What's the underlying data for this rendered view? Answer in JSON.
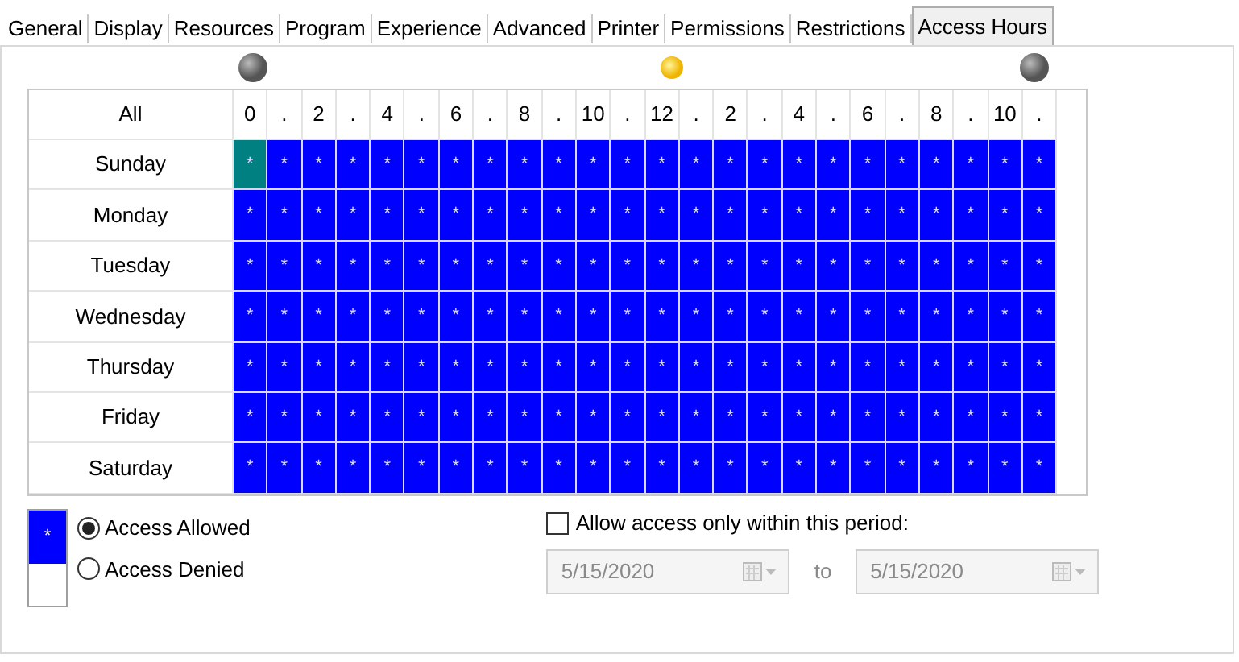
{
  "tabs": [
    {
      "label": "General",
      "selected": false
    },
    {
      "label": "Display",
      "selected": false
    },
    {
      "label": "Resources",
      "selected": false
    },
    {
      "label": "Program",
      "selected": false
    },
    {
      "label": "Experience",
      "selected": false
    },
    {
      "label": "Advanced",
      "selected": false
    },
    {
      "label": "Printer",
      "selected": false
    },
    {
      "label": "Permissions",
      "selected": false
    },
    {
      "label": "Restrictions",
      "selected": false
    },
    {
      "label": "Access Hours",
      "selected": true
    }
  ],
  "grid": {
    "all_label": "All",
    "hour_headers": [
      "0",
      ".",
      "2",
      ".",
      "4",
      ".",
      "6",
      ".",
      "8",
      ".",
      "10",
      ".",
      "12",
      ".",
      "2",
      ".",
      "4",
      ".",
      "6",
      ".",
      "8",
      ".",
      "10",
      "."
    ],
    "rows": [
      {
        "day": "Sunday",
        "cells": [
          {
            "mark": "*",
            "allowed": true,
            "selected": true
          },
          {
            "mark": "*",
            "allowed": true,
            "selected": false
          },
          {
            "mark": "*",
            "allowed": true,
            "selected": false
          },
          {
            "mark": "*",
            "allowed": true,
            "selected": false
          },
          {
            "mark": "*",
            "allowed": true,
            "selected": false
          },
          {
            "mark": "*",
            "allowed": true,
            "selected": false
          },
          {
            "mark": "*",
            "allowed": true,
            "selected": false
          },
          {
            "mark": "*",
            "allowed": true,
            "selected": false
          },
          {
            "mark": "*",
            "allowed": true,
            "selected": false
          },
          {
            "mark": "*",
            "allowed": true,
            "selected": false
          },
          {
            "mark": "*",
            "allowed": true,
            "selected": false
          },
          {
            "mark": "*",
            "allowed": true,
            "selected": false
          },
          {
            "mark": "*",
            "allowed": true,
            "selected": false
          },
          {
            "mark": "*",
            "allowed": true,
            "selected": false
          },
          {
            "mark": "*",
            "allowed": true,
            "selected": false
          },
          {
            "mark": "*",
            "allowed": true,
            "selected": false
          },
          {
            "mark": "*",
            "allowed": true,
            "selected": false
          },
          {
            "mark": "*",
            "allowed": true,
            "selected": false
          },
          {
            "mark": "*",
            "allowed": true,
            "selected": false
          },
          {
            "mark": "*",
            "allowed": true,
            "selected": false
          },
          {
            "mark": "*",
            "allowed": true,
            "selected": false
          },
          {
            "mark": "*",
            "allowed": true,
            "selected": false
          },
          {
            "mark": "*",
            "allowed": true,
            "selected": false
          },
          {
            "mark": "*",
            "allowed": true,
            "selected": false
          }
        ]
      },
      {
        "day": "Monday",
        "cells": [
          {
            "mark": "*",
            "allowed": true,
            "selected": false
          },
          {
            "mark": "*",
            "allowed": true,
            "selected": false
          },
          {
            "mark": "*",
            "allowed": true,
            "selected": false
          },
          {
            "mark": "*",
            "allowed": true,
            "selected": false
          },
          {
            "mark": "*",
            "allowed": true,
            "selected": false
          },
          {
            "mark": "*",
            "allowed": true,
            "selected": false
          },
          {
            "mark": "*",
            "allowed": true,
            "selected": false
          },
          {
            "mark": "*",
            "allowed": true,
            "selected": false
          },
          {
            "mark": "*",
            "allowed": true,
            "selected": false
          },
          {
            "mark": "*",
            "allowed": true,
            "selected": false
          },
          {
            "mark": "*",
            "allowed": true,
            "selected": false
          },
          {
            "mark": "*",
            "allowed": true,
            "selected": false
          },
          {
            "mark": "*",
            "allowed": true,
            "selected": false
          },
          {
            "mark": "*",
            "allowed": true,
            "selected": false
          },
          {
            "mark": "*",
            "allowed": true,
            "selected": false
          },
          {
            "mark": "*",
            "allowed": true,
            "selected": false
          },
          {
            "mark": "*",
            "allowed": true,
            "selected": false
          },
          {
            "mark": "*",
            "allowed": true,
            "selected": false
          },
          {
            "mark": "*",
            "allowed": true,
            "selected": false
          },
          {
            "mark": "*",
            "allowed": true,
            "selected": false
          },
          {
            "mark": "*",
            "allowed": true,
            "selected": false
          },
          {
            "mark": "*",
            "allowed": true,
            "selected": false
          },
          {
            "mark": "*",
            "allowed": true,
            "selected": false
          },
          {
            "mark": "*",
            "allowed": true,
            "selected": false
          }
        ]
      },
      {
        "day": "Tuesday",
        "cells": [
          {
            "mark": "*",
            "allowed": true,
            "selected": false
          },
          {
            "mark": "*",
            "allowed": true,
            "selected": false
          },
          {
            "mark": "*",
            "allowed": true,
            "selected": false
          },
          {
            "mark": "*",
            "allowed": true,
            "selected": false
          },
          {
            "mark": "*",
            "allowed": true,
            "selected": false
          },
          {
            "mark": "*",
            "allowed": true,
            "selected": false
          },
          {
            "mark": "*",
            "allowed": true,
            "selected": false
          },
          {
            "mark": "*",
            "allowed": true,
            "selected": false
          },
          {
            "mark": "*",
            "allowed": true,
            "selected": false
          },
          {
            "mark": "*",
            "allowed": true,
            "selected": false
          },
          {
            "mark": "*",
            "allowed": true,
            "selected": false
          },
          {
            "mark": "*",
            "allowed": true,
            "selected": false
          },
          {
            "mark": "*",
            "allowed": true,
            "selected": false
          },
          {
            "mark": "*",
            "allowed": true,
            "selected": false
          },
          {
            "mark": "*",
            "allowed": true,
            "selected": false
          },
          {
            "mark": "*",
            "allowed": true,
            "selected": false
          },
          {
            "mark": "*",
            "allowed": true,
            "selected": false
          },
          {
            "mark": "*",
            "allowed": true,
            "selected": false
          },
          {
            "mark": "*",
            "allowed": true,
            "selected": false
          },
          {
            "mark": "*",
            "allowed": true,
            "selected": false
          },
          {
            "mark": "*",
            "allowed": true,
            "selected": false
          },
          {
            "mark": "*",
            "allowed": true,
            "selected": false
          },
          {
            "mark": "*",
            "allowed": true,
            "selected": false
          },
          {
            "mark": "*",
            "allowed": true,
            "selected": false
          }
        ]
      },
      {
        "day": "Wednesday",
        "cells": [
          {
            "mark": "*",
            "allowed": true,
            "selected": false
          },
          {
            "mark": "*",
            "allowed": true,
            "selected": false
          },
          {
            "mark": "*",
            "allowed": true,
            "selected": false
          },
          {
            "mark": "*",
            "allowed": true,
            "selected": false
          },
          {
            "mark": "*",
            "allowed": true,
            "selected": false
          },
          {
            "mark": "*",
            "allowed": true,
            "selected": false
          },
          {
            "mark": "*",
            "allowed": true,
            "selected": false
          },
          {
            "mark": "*",
            "allowed": true,
            "selected": false
          },
          {
            "mark": "*",
            "allowed": true,
            "selected": false
          },
          {
            "mark": "*",
            "allowed": true,
            "selected": false
          },
          {
            "mark": "*",
            "allowed": true,
            "selected": false
          },
          {
            "mark": "*",
            "allowed": true,
            "selected": false
          },
          {
            "mark": "*",
            "allowed": true,
            "selected": false
          },
          {
            "mark": "*",
            "allowed": true,
            "selected": false
          },
          {
            "mark": "*",
            "allowed": true,
            "selected": false
          },
          {
            "mark": "*",
            "allowed": true,
            "selected": false
          },
          {
            "mark": "*",
            "allowed": true,
            "selected": false
          },
          {
            "mark": "*",
            "allowed": true,
            "selected": false
          },
          {
            "mark": "*",
            "allowed": true,
            "selected": false
          },
          {
            "mark": "*",
            "allowed": true,
            "selected": false
          },
          {
            "mark": "*",
            "allowed": true,
            "selected": false
          },
          {
            "mark": "*",
            "allowed": true,
            "selected": false
          },
          {
            "mark": "*",
            "allowed": true,
            "selected": false
          },
          {
            "mark": "*",
            "allowed": true,
            "selected": false
          }
        ]
      },
      {
        "day": "Thursday",
        "cells": [
          {
            "mark": "*",
            "allowed": true,
            "selected": false
          },
          {
            "mark": "*",
            "allowed": true,
            "selected": false
          },
          {
            "mark": "*",
            "allowed": true,
            "selected": false
          },
          {
            "mark": "*",
            "allowed": true,
            "selected": false
          },
          {
            "mark": "*",
            "allowed": true,
            "selected": false
          },
          {
            "mark": "*",
            "allowed": true,
            "selected": false
          },
          {
            "mark": "*",
            "allowed": true,
            "selected": false
          },
          {
            "mark": "*",
            "allowed": true,
            "selected": false
          },
          {
            "mark": "*",
            "allowed": true,
            "selected": false
          },
          {
            "mark": "*",
            "allowed": true,
            "selected": false
          },
          {
            "mark": "*",
            "allowed": true,
            "selected": false
          },
          {
            "mark": "*",
            "allowed": true,
            "selected": false
          },
          {
            "mark": "*",
            "allowed": true,
            "selected": false
          },
          {
            "mark": "*",
            "allowed": true,
            "selected": false
          },
          {
            "mark": "*",
            "allowed": true,
            "selected": false
          },
          {
            "mark": "*",
            "allowed": true,
            "selected": false
          },
          {
            "mark": "*",
            "allowed": true,
            "selected": false
          },
          {
            "mark": "*",
            "allowed": true,
            "selected": false
          },
          {
            "mark": "*",
            "allowed": true,
            "selected": false
          },
          {
            "mark": "*",
            "allowed": true,
            "selected": false
          },
          {
            "mark": "*",
            "allowed": true,
            "selected": false
          },
          {
            "mark": "*",
            "allowed": true,
            "selected": false
          },
          {
            "mark": "*",
            "allowed": true,
            "selected": false
          },
          {
            "mark": "*",
            "allowed": true,
            "selected": false
          }
        ]
      },
      {
        "day": "Friday",
        "cells": [
          {
            "mark": "*",
            "allowed": true,
            "selected": false
          },
          {
            "mark": "*",
            "allowed": true,
            "selected": false
          },
          {
            "mark": "*",
            "allowed": true,
            "selected": false
          },
          {
            "mark": "*",
            "allowed": true,
            "selected": false
          },
          {
            "mark": "*",
            "allowed": true,
            "selected": false
          },
          {
            "mark": "*",
            "allowed": true,
            "selected": false
          },
          {
            "mark": "*",
            "allowed": true,
            "selected": false
          },
          {
            "mark": "*",
            "allowed": true,
            "selected": false
          },
          {
            "mark": "*",
            "allowed": true,
            "selected": false
          },
          {
            "mark": "*",
            "allowed": true,
            "selected": false
          },
          {
            "mark": "*",
            "allowed": true,
            "selected": false
          },
          {
            "mark": "*",
            "allowed": true,
            "selected": false
          },
          {
            "mark": "*",
            "allowed": true,
            "selected": false
          },
          {
            "mark": "*",
            "allowed": true,
            "selected": false
          },
          {
            "mark": "*",
            "allowed": true,
            "selected": false
          },
          {
            "mark": "*",
            "allowed": true,
            "selected": false
          },
          {
            "mark": "*",
            "allowed": true,
            "selected": false
          },
          {
            "mark": "*",
            "allowed": true,
            "selected": false
          },
          {
            "mark": "*",
            "allowed": true,
            "selected": false
          },
          {
            "mark": "*",
            "allowed": true,
            "selected": false
          },
          {
            "mark": "*",
            "allowed": true,
            "selected": false
          },
          {
            "mark": "*",
            "allowed": true,
            "selected": false
          },
          {
            "mark": "*",
            "allowed": true,
            "selected": false
          },
          {
            "mark": "*",
            "allowed": true,
            "selected": false
          }
        ]
      },
      {
        "day": "Saturday",
        "cells": [
          {
            "mark": "*",
            "allowed": true,
            "selected": false
          },
          {
            "mark": "*",
            "allowed": true,
            "selected": false
          },
          {
            "mark": "*",
            "allowed": true,
            "selected": false
          },
          {
            "mark": "*",
            "allowed": true,
            "selected": false
          },
          {
            "mark": "*",
            "allowed": true,
            "selected": false
          },
          {
            "mark": "*",
            "allowed": true,
            "selected": false
          },
          {
            "mark": "*",
            "allowed": true,
            "selected": false
          },
          {
            "mark": "*",
            "allowed": true,
            "selected": false
          },
          {
            "mark": "*",
            "allowed": true,
            "selected": false
          },
          {
            "mark": "*",
            "allowed": true,
            "selected": false
          },
          {
            "mark": "*",
            "allowed": true,
            "selected": false
          },
          {
            "mark": "*",
            "allowed": true,
            "selected": false
          },
          {
            "mark": "*",
            "allowed": true,
            "selected": false
          },
          {
            "mark": "*",
            "allowed": true,
            "selected": false
          },
          {
            "mark": "*",
            "allowed": true,
            "selected": false
          },
          {
            "mark": "*",
            "allowed": true,
            "selected": false
          },
          {
            "mark": "*",
            "allowed": true,
            "selected": false
          },
          {
            "mark": "*",
            "allowed": true,
            "selected": false
          },
          {
            "mark": "*",
            "allowed": true,
            "selected": false
          },
          {
            "mark": "*",
            "allowed": true,
            "selected": false
          },
          {
            "mark": "*",
            "allowed": true,
            "selected": false
          },
          {
            "mark": "*",
            "allowed": true,
            "selected": false
          },
          {
            "mark": "*",
            "allowed": true,
            "selected": false
          },
          {
            "mark": "*",
            "allowed": true,
            "selected": false
          }
        ]
      }
    ]
  },
  "legend": {
    "mark": "*"
  },
  "access_options": [
    {
      "label": "Access Allowed",
      "selected": true
    },
    {
      "label": "Access Denied",
      "selected": false
    }
  ],
  "period": {
    "label": "Allow access only within this period:",
    "checked": false,
    "from": "5/15/2020",
    "separator": "to",
    "until": "5/15/2020",
    "disabled": true
  }
}
